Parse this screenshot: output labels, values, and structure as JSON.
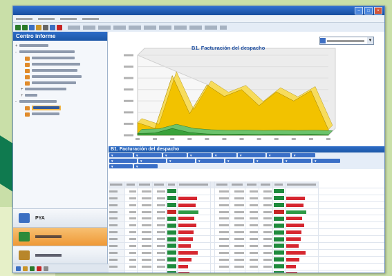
{
  "window": {
    "title": "",
    "controls": [
      "minimize-icon",
      "maximize-icon",
      "close-icon"
    ]
  },
  "menubar": {
    "items": [
      "",
      "",
      "",
      ""
    ]
  },
  "toolbar": {
    "icons": [
      "back-icon",
      "forward-icon",
      "refresh-icon",
      "home-icon",
      "print-icon",
      "export-icon",
      "help-icon"
    ],
    "status_text": ""
  },
  "sidebar": {
    "title": "Centro informe",
    "tree": [
      {
        "level": 0,
        "expander": "+",
        "icon": false,
        "selected": false,
        "w": 42
      },
      {
        "level": 0,
        "expander": "-",
        "icon": false,
        "selected": false,
        "w": 80
      },
      {
        "level": 1,
        "expander": "",
        "icon": true,
        "selected": false,
        "w": 62
      },
      {
        "level": 1,
        "expander": "",
        "icon": true,
        "selected": false,
        "w": 70
      },
      {
        "level": 1,
        "expander": "",
        "icon": true,
        "selected": false,
        "w": 66
      },
      {
        "level": 1,
        "expander": "",
        "icon": true,
        "selected": false,
        "w": 72
      },
      {
        "level": 1,
        "expander": "",
        "icon": true,
        "selected": false,
        "w": 64
      },
      {
        "level": 1,
        "expander": "+",
        "icon": false,
        "selected": false,
        "w": 60
      },
      {
        "level": 1,
        "expander": "+",
        "icon": false,
        "selected": false,
        "w": 18
      },
      {
        "level": 0,
        "expander": "-",
        "icon": false,
        "selected": false,
        "w": 54
      },
      {
        "level": 1,
        "expander": "",
        "icon": true,
        "selected": true,
        "w": 38
      },
      {
        "level": 1,
        "expander": "",
        "icon": true,
        "selected": false,
        "w": 40
      }
    ],
    "nav": [
      {
        "label": "PYA",
        "active": false,
        "color": "#3b6fc2"
      },
      {
        "label": "",
        "active": true,
        "color": "#2d8a3a"
      },
      {
        "label": "",
        "active": false,
        "color": "#b8862a"
      }
    ],
    "footer_icons": [
      "mail-icon",
      "calendar-icon",
      "tasks-icon",
      "contacts-icon",
      "notes-icon"
    ]
  },
  "chart_panel": {
    "title": "B1. Facturación del despacho",
    "selector_value": "",
    "legend": [
      {
        "label": "",
        "color": "#f2c200"
      },
      {
        "label": "",
        "color": "#3aa23a"
      }
    ]
  },
  "chart_data": {
    "type": "area",
    "title": "B1. Facturación del despacho",
    "x": [
      1,
      2,
      3,
      4,
      5,
      6,
      7,
      8,
      9,
      10,
      11,
      12
    ],
    "ylim": [
      0,
      350
    ],
    "yticks": [
      "",
      "",
      "",
      "",
      "",
      "",
      "",
      ""
    ],
    "series": [
      {
        "color": "#f2c200",
        "values": [
          55,
          30,
          260,
          95,
          220,
          170,
          200,
          130,
          190,
          150,
          195,
          25
        ]
      },
      {
        "color": "#3aa23a",
        "values": [
          8,
          10,
          30,
          12,
          6,
          4,
          5,
          3,
          4,
          3,
          4,
          2
        ]
      }
    ],
    "grid": true,
    "legend": "top-right"
  },
  "pivot": {
    "title": "",
    "filters": [
      5,
      6,
      5,
      5,
      5,
      6,
      5,
      5
    ],
    "columns_fields": [
      6,
      6,
      6,
      6,
      6,
      6,
      6,
      6
    ],
    "rows_field": [
      5,
      5
    ],
    "rows": [
      {
        "status": "good",
        "bar": 0.0
      },
      {
        "status": "good",
        "bar": 0.58
      },
      {
        "status": "good",
        "bar": 0.55
      },
      {
        "status": "bad",
        "bar": 0.62
      },
      {
        "status": "good",
        "bar": 0.5
      },
      {
        "status": "good",
        "bar": 0.56
      },
      {
        "status": "good",
        "bar": 0.48
      },
      {
        "status": "good",
        "bar": 0.45
      },
      {
        "status": "good",
        "bar": 0.4
      },
      {
        "status": "good",
        "bar": 0.6
      },
      {
        "status": "good",
        "bar": 0.42
      },
      {
        "status": "good",
        "bar": 0.3
      },
      {
        "status": "good",
        "bar": 0.35
      },
      {
        "status": "bad",
        "bar": 0.25
      }
    ]
  },
  "colors": {
    "accent": "#1c57a7",
    "area_yellow": "#f2c200",
    "area_green": "#3aa23a",
    "status_good": "#1e8a3c",
    "status_bad": "#c62424"
  }
}
